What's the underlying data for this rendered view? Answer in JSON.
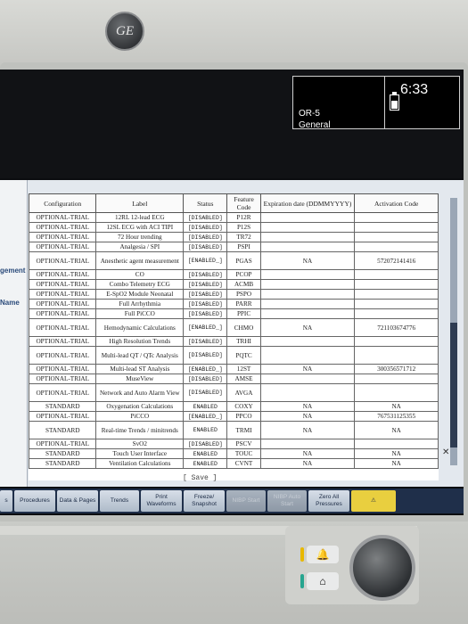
{
  "device": {
    "logo_text": "GE"
  },
  "status_bar": {
    "room": "OR-5",
    "mode": "General",
    "clock": "6:33"
  },
  "side_panel": {
    "label_1": "gement",
    "label_2": "Name"
  },
  "table": {
    "headers": [
      "Configuration",
      "Label",
      "Status",
      "Feature Code",
      "Expiration date (DDMMYYYY)",
      "Activation Code"
    ],
    "rows": [
      {
        "cfg": "OPTIONAL-TRIAL",
        "label": "12RL 12-lead ECG",
        "status": "[DISABLED]",
        "code": "P12R",
        "exp": "",
        "act": ""
      },
      {
        "cfg": "OPTIONAL-TRIAL",
        "label": "12SL ECG with ACI TIPI",
        "status": "[DISABLED]",
        "code": "P12S",
        "exp": "",
        "act": ""
      },
      {
        "cfg": "OPTIONAL-TRIAL",
        "label": "72 Hour trending",
        "status": "[DISABLED]",
        "code": "TR72",
        "exp": "",
        "act": ""
      },
      {
        "cfg": "OPTIONAL-TRIAL",
        "label": "Analgesia / SPI",
        "status": "[DISABLED]",
        "code": "PSPI",
        "exp": "",
        "act": ""
      },
      {
        "cfg": "OPTIONAL-TRIAL",
        "label": "Anesthetic agent measurement",
        "status": "[ENABLED_]",
        "code": "PGAS",
        "exp": "NA",
        "act": "572072141416"
      },
      {
        "cfg": "OPTIONAL-TRIAL",
        "label": "CO",
        "status": "[DISABLED]",
        "code": "PCOP",
        "exp": "",
        "act": ""
      },
      {
        "cfg": "OPTIONAL-TRIAL",
        "label": "Combo Telemetry ECG",
        "status": "[DISABLED]",
        "code": "ACMB",
        "exp": "",
        "act": ""
      },
      {
        "cfg": "OPTIONAL-TRIAL",
        "label": "E-SpO2 Module Neonatal",
        "status": "[DISABLED]",
        "code": "PSPO",
        "exp": "",
        "act": ""
      },
      {
        "cfg": "OPTIONAL-TRIAL",
        "label": "Full Arrhythmia",
        "status": "[DISABLED]",
        "code": "PARR",
        "exp": "",
        "act": ""
      },
      {
        "cfg": "OPTIONAL-TRIAL",
        "label": "Full PiCCO",
        "status": "[DISABLED]",
        "code": "PPIC",
        "exp": "",
        "act": ""
      },
      {
        "cfg": "OPTIONAL-TRIAL",
        "label": "Hemodynamic Calculations",
        "status": "[ENABLED_]",
        "code": "CHMO",
        "exp": "NA",
        "act": "721103674776"
      },
      {
        "cfg": "OPTIONAL-TRIAL",
        "label": "High Resolution Trends",
        "status": "[DISABLED]",
        "code": "TRHI",
        "exp": "",
        "act": ""
      },
      {
        "cfg": "OPTIONAL-TRIAL",
        "label": "Multi-lead QT / QTc Analysis",
        "status": "[DISABLED]",
        "code": "PQTC",
        "exp": "",
        "act": ""
      },
      {
        "cfg": "OPTIONAL-TRIAL",
        "label": "Multi-lead ST Analysis",
        "status": "[ENABLED_]",
        "code": "12ST",
        "exp": "NA",
        "act": "300356571712"
      },
      {
        "cfg": "OPTIONAL-TRIAL",
        "label": "MuseView",
        "status": "[DISABLED]",
        "code": "AMSE",
        "exp": "",
        "act": ""
      },
      {
        "cfg": "OPTIONAL-TRIAL",
        "label": "Network and Auto Alarm View",
        "status": "[DISABLED]",
        "code": "AVGA",
        "exp": "",
        "act": ""
      },
      {
        "cfg": "STANDARD",
        "label": "Oxygenation Calculations",
        "status": "ENABLED",
        "code": "COXY",
        "exp": "NA",
        "act": "NA"
      },
      {
        "cfg": "OPTIONAL-TRIAL",
        "label": "PiCCO",
        "status": "[ENABLED_]",
        "code": "PPCO",
        "exp": "NA",
        "act": "767531125355"
      },
      {
        "cfg": "STANDARD",
        "label": "Real-time Trends / minitrends",
        "status": "ENABLED",
        "code": "TRMI",
        "exp": "NA",
        "act": "NA"
      },
      {
        "cfg": "OPTIONAL-TRIAL",
        "label": "SvO2",
        "status": "[DISABLED]",
        "code": "PSCV",
        "exp": "",
        "act": ""
      },
      {
        "cfg": "STANDARD",
        "label": "Touch User Interface",
        "status": "ENABLED",
        "code": "TOUC",
        "exp": "NA",
        "act": "NA"
      },
      {
        "cfg": "STANDARD",
        "label": "Ventilation Calculations",
        "status": "ENABLED",
        "code": "CVNT",
        "exp": "NA",
        "act": "NA"
      }
    ],
    "save_label": "[ Save ]"
  },
  "toolbar": {
    "buttons": [
      {
        "label": "s",
        "disabled": false
      },
      {
        "label": "Procedures",
        "disabled": false
      },
      {
        "label": "Data & Pages",
        "disabled": false
      },
      {
        "label": "Trends",
        "disabled": false
      },
      {
        "label": "Print Waveforms",
        "disabled": false
      },
      {
        "label": "Freeze/ Snapshot",
        "disabled": false
      },
      {
        "label": "NIBP Start",
        "disabled": true
      },
      {
        "label": "NIBP Auto Start",
        "disabled": true
      },
      {
        "label": "Zero All Pressures",
        "disabled": false
      },
      {
        "label": "",
        "disabled": false
      }
    ]
  },
  "colors": {
    "toolbar_bg": "#1f2f4a",
    "alarm_yellow": "#e9cf3f",
    "alarm_led_yellow": "#e8b800",
    "alarm_led_teal": "#27a58f"
  }
}
